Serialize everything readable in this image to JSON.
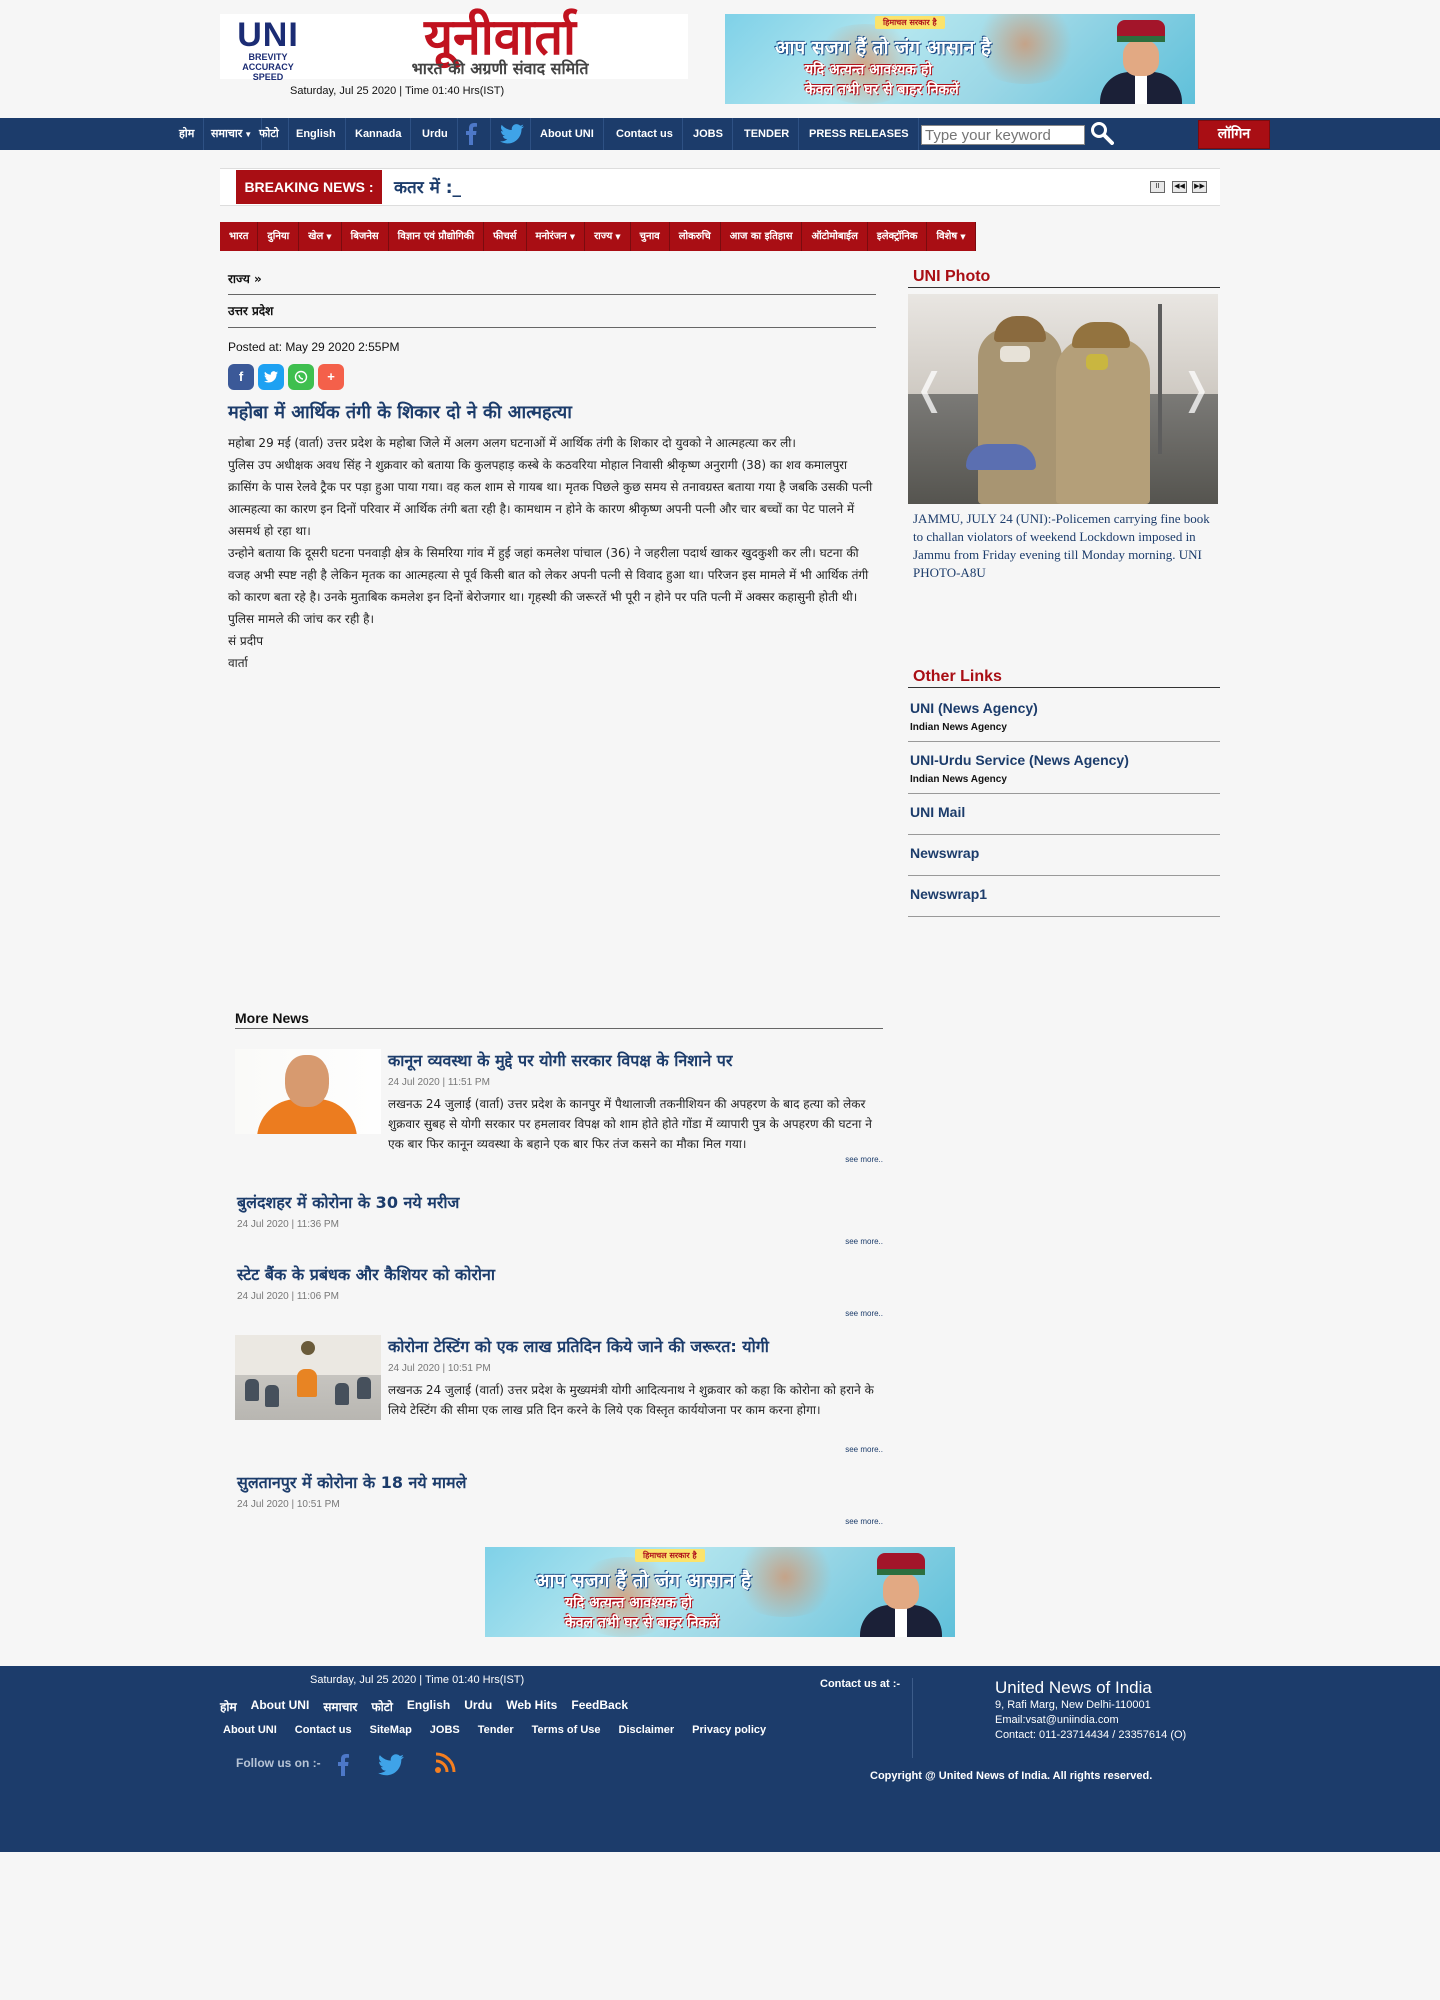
{
  "header": {
    "logo_en": "UNI",
    "logo_tagline": [
      "BREVITY",
      "ACCURACY",
      "SPEED"
    ],
    "logo_hi": "यूनीवार्ता",
    "logo_hi_sub": "भारत की अग्रणी संवाद समिति",
    "datetime": "Saturday, Jul 25 2020 | Time 01:40 Hrs(IST)"
  },
  "banner": {
    "tag": "हिमाचल सरकार है",
    "line1": "आप सजग हैं तो जंग आसान है",
    "line2": "यदि अत्यन्त आवश्यक हो",
    "line3": "केवल तभी घर से बाहर निकलें"
  },
  "nav": {
    "items": [
      "होम",
      "समाचार",
      "फोटो",
      "English",
      "Kannada",
      "Urdu",
      "About UNI",
      "Contact us",
      "JOBS",
      "TENDER",
      "PRESS RELEASES"
    ],
    "search_placeholder": "Type your keyword",
    "login": "लॉगिन"
  },
  "breaking": {
    "label": "BREAKING NEWS :",
    "ticker": "कतर में :_",
    "controls": [
      "II",
      "◀◀",
      "▶▶"
    ]
  },
  "categories": [
    "भारत",
    "दुनिया",
    "खेल",
    "बिजनेस",
    "विज्ञान एवं प्रौद्योगिकी",
    "फीचर्स",
    "मनोरंजन",
    "राज्य",
    "चुनाव",
    "लोकरुचि",
    "आज का इतिहास",
    "ऑटोमोबाईल",
    "इलेक्ट्रॉनिक",
    "विशेष"
  ],
  "article": {
    "crumb": "राज्य »",
    "state": "उत्तर प्रदेश",
    "posted": "Posted at: May 29 2020 2:55PM",
    "title": "महोबा में आर्थिक तंगी के शिकार दो ने की आत्महत्या",
    "paragraphs": [
      "महोबा 29 मई (वार्ता) उत्तर प्रदेश के महोबा जिले में अलग अलग घटनाओं में आर्थिक तंगी के शिकार दो युवको ने आत्महत्या कर ली।",
      "पुलिस उप अधीक्षक अवध सिंह ने शुक्रवार को बताया कि कुलपहाड़ कस्बे के कठवरिया मोहाल निवासी श्रीकृष्ण अनुरागी (38) का शव कमालपुरा क्रासिंग के पास रेलवे ट्रैक पर पड़ा हुआ पाया गया। वह कल शाम से गायब था। मृतक पिछले कुछ समय से तनावग्रस्त बताया गया है जबकि उसकी पत्नी आत्महत्या का कारण इन दिनों परिवार में आर्थिक तंगी बता रही है। कामधाम न होने के कारण श्रीकृष्ण अपनी पत्नी और चार बच्चों का पेट पालने में असमर्थ हो रहा था।",
      "उन्होने बताया कि दूसरी घटना पनवाड़ी क्षेत्र के सिमरिया गांव में हुई जहां कमलेश पांचाल (36) ने जहरीला पदार्थ खाकर खुदकुशी कर ली। घटना की वजह अभी स्पष्ट नही है लेकिन मृतक का आत्महत्या से पूर्व किसी बात को लेकर अपनी पत्नी से विवाद हुआ था। परिजन इस मामले में भी आर्थिक तंगी को कारण बता रहे है। उनके मुताबिक कमलेश इन दिनों बेरोजगार था। गृहस्थी की जरूरतें भी पूरी न होने पर पति पत्नी में अक्सर कहासुनी होती थी। पुलिस मामले की जांच कर रही है।",
      "सं प्रदीप",
      "वार्ता"
    ]
  },
  "sidebar": {
    "photo_head": "UNI Photo",
    "photo_caption": "JAMMU, JULY 24 (UNI):-Policemen carrying fine book to challan violators of weekend Lockdown imposed in Jammu from Friday evening till Monday morning. UNI PHOTO-A8U",
    "links_head": "Other Links",
    "links": [
      {
        "title": "UNI (News Agency)",
        "sub": "Indian News Agency"
      },
      {
        "title": "UNI-Urdu Service (News Agency)",
        "sub": "Indian News Agency"
      },
      {
        "title": "UNI Mail",
        "sub": ""
      },
      {
        "title": "Newswrap",
        "sub": ""
      },
      {
        "title": "Newswrap1",
        "sub": ""
      }
    ]
  },
  "more_news": {
    "head": "More News",
    "see_more": "see more..",
    "items": [
      {
        "title": "कानून व्यवस्था के मुद्दे पर योगी सरकार विपक्ष के निशाने पर",
        "date": "24 Jul 2020 | 11:51 PM",
        "summary": "लखनऊ 24 जुलाई (वार्ता) उत्तर प्रदेश के कानपुर में पैथालाजी तकनीशियन की अपहरण के बाद हत्या को लेकर शुक्रवार सुबह से योगी सरकार पर हमलावर विपक्ष को शाम होते होते गोंडा में व्यापारी पुत्र के अपहरण की घटना ने एक बार फिर कानून व्यवस्था के बहाने एक बार फिर तंज कसने का मौका मिल गया।"
      },
      {
        "title": "बुलंदशहर में कोरोना के 30 नये मरीज",
        "date": "24 Jul 2020 | 11:36 PM",
        "summary": ""
      },
      {
        "title": "स्टेट बैंक के प्रबंधक और कैशियर को कोरोना",
        "date": "24 Jul 2020 | 11:06 PM",
        "summary": ""
      },
      {
        "title": "कोरोना टेस्टिंग को एक लाख प्रतिदिन किये जाने की जरूरत: योगी",
        "date": "24 Jul 2020 | 10:51 PM",
        "summary": "लखनऊ 24 जुलाई (वार्ता) उत्तर प्रदेश के मुख्यमंत्री योगी आदित्यनाथ ने शुक्रवार को कहा कि कोरोना को हराने के लिये टेस्टिंग की सीमा एक लाख प्रति दिन करने के लिये एक विस्तृत कार्ययोजना पर काम करना होगा।"
      },
      {
        "title": "सुलतानपुर में कोरोना के 18 नये मामले",
        "date": "24 Jul 2020 | 10:51 PM",
        "summary": ""
      }
    ]
  },
  "footer": {
    "datetime": "Saturday, Jul 25 2020 | Time 01:40 Hrs(IST)",
    "nav1": [
      "होम",
      "About UNI",
      "समाचार",
      "फोटो",
      "English",
      "Urdu",
      "Web Hits",
      "FeedBack"
    ],
    "nav2": [
      "About UNI",
      "Contact us",
      "SiteMap",
      "JOBS",
      "Tender",
      "Terms of Use",
      "Disclaimer",
      "Privacy policy"
    ],
    "follow": "Follow us on :-",
    "contact_label": "Contact us at :-",
    "org_name": "United News of India",
    "address": "9, Rafi Marg, New Delhi-110001",
    "email": "Email:vsat@uniindia.com",
    "phone": "Contact: 011-23714434 / 23357614 (O)",
    "copyright": "Copyright @ United News of India. All rights reserved."
  },
  "colors": {
    "navy": "#1c3c6b",
    "red": "#a90e14"
  }
}
